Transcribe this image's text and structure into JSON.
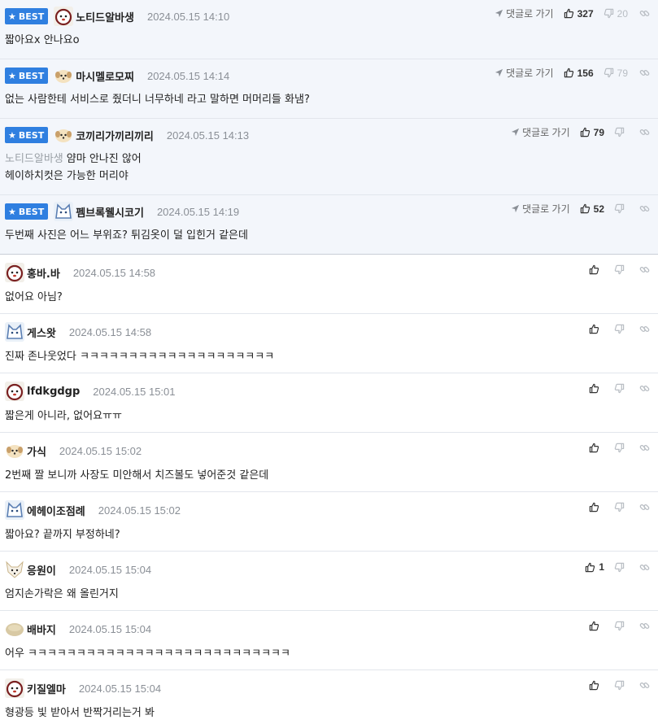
{
  "labels": {
    "best_badge": "BEST",
    "goto_reply": "댓글로 가기"
  },
  "colors": {
    "badge": "#2f7fe0",
    "best_bg": "#f3f6fb",
    "divider": "#e2e6ec",
    "date": "#8a8f96"
  },
  "best_comments": [
    {
      "nick": "노티드알바생",
      "avatar": "dog-red-icon",
      "date": "2024.05.15 14:10",
      "likes": "327",
      "dislikes": "20",
      "text": "짧아요x 안나요o"
    },
    {
      "nick": "마시멜로모찌",
      "avatar": "dog-tan-icon",
      "date": "2024.05.15 14:14",
      "likes": "156",
      "dislikes": "79",
      "text": "없는 사람한테 서비스로 줬더니 너무하네 라고 말하면 머머리들 화냄?"
    },
    {
      "nick": "코끼리가끼리끼리",
      "avatar": "dog-tan-icon",
      "date": "2024.05.15 14:13",
      "likes": "79",
      "dislikes": "",
      "quote_nick": "노티드알바생",
      "text": "얌마 안나진 않어",
      "text2": "헤이하치컷은 가능한 머리야"
    },
    {
      "nick": "펨브록웰시코기",
      "avatar": "cat-blue-icon",
      "date": "2024.05.15 14:19",
      "likes": "52",
      "dislikes": "",
      "text": "두번째 사진은 어느 부위죠? 튀김옷이 덜 입힌거 같은데"
    }
  ],
  "comments": [
    {
      "nick": "홍바.바",
      "avatar": "dog-red-icon",
      "date": "2024.05.15 14:58",
      "likes": "",
      "text": "없어요 아님?"
    },
    {
      "nick": "게스왓",
      "avatar": "cat-blue-icon",
      "date": "2024.05.15 14:58",
      "likes": "",
      "text": "진짜 존나웃었다 ㅋㅋㅋㅋㅋㅋㅋㅋㅋㅋㅋㅋㅋㅋㅋㅋㅋㅋㅋㅋ"
    },
    {
      "nick": "lfdkgdgp",
      "avatar": "dog-red-icon",
      "date": "2024.05.15 15:01",
      "likes": "",
      "text": "짧은게 아니라, 없어요ㅠㅠ"
    },
    {
      "nick": "가식",
      "avatar": "dog-tan-icon",
      "date": "2024.05.15 15:02",
      "likes": "",
      "text": "2번째 짤 보니까 사장도 미안해서 치즈볼도 넣어준것 같은데"
    },
    {
      "nick": "에헤이조점례",
      "avatar": "cat-blue-icon",
      "date": "2024.05.15 15:02",
      "likes": "",
      "text": "짧아요? 끝까지 부정하네?"
    },
    {
      "nick": "응원이",
      "avatar": "fox-icon",
      "date": "2024.05.15 15:04",
      "likes": "1",
      "text": "엄지손가락은 왜 올린거지"
    },
    {
      "nick": "배바지",
      "avatar": "potato-icon",
      "date": "2024.05.15 15:04",
      "likes": "",
      "text": "어우 ㅋㅋㅋㅋㅋㅋㅋㅋㅋㅋㅋㅋㅋㅋㅋㅋㅋㅋㅋㅋㅋㅋㅋㅋㅋㅋㅋ"
    },
    {
      "nick": "키질엘마",
      "avatar": "dog-red-icon",
      "date": "2024.05.15 15:04",
      "likes": "",
      "text": "형광등 빛 받아서 반짝거리는거 봐"
    }
  ]
}
